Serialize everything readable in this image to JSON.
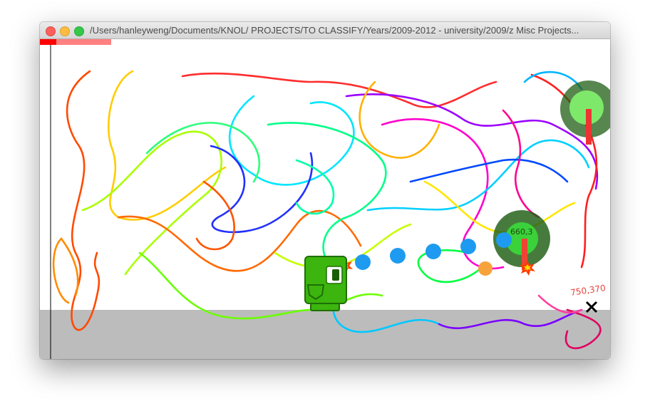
{
  "window": {
    "title": "/Users/hanleyweng/Documents/KNOL/ PROJECTS/TO CLASSIFY/Years/2009-2012 - university/2009/z Misc Projects...",
    "buttons": {
      "close": "close",
      "minimize": "minimize",
      "maximize": "maximize"
    }
  },
  "game": {
    "health_fraction": 0.23,
    "bullet_count": 5,
    "enemy_count": 2,
    "labels": {
      "cursor_coords": "750,370",
      "enemy_coords": "660,3"
    },
    "colors": {
      "ground": "#bcbcbc",
      "player": "#3cb50e",
      "bullet": "#1e9bf0",
      "enemy_outer": "#1f5e14",
      "enemy_inner": "#7ee86a",
      "health_bar": "#ff0000",
      "health_bar_bg": "#ff8080",
      "orange_ball": "#f7a23b"
    },
    "icons": [
      "player-robot-icon",
      "explosion-icon",
      "cursor-x-icon"
    ]
  }
}
